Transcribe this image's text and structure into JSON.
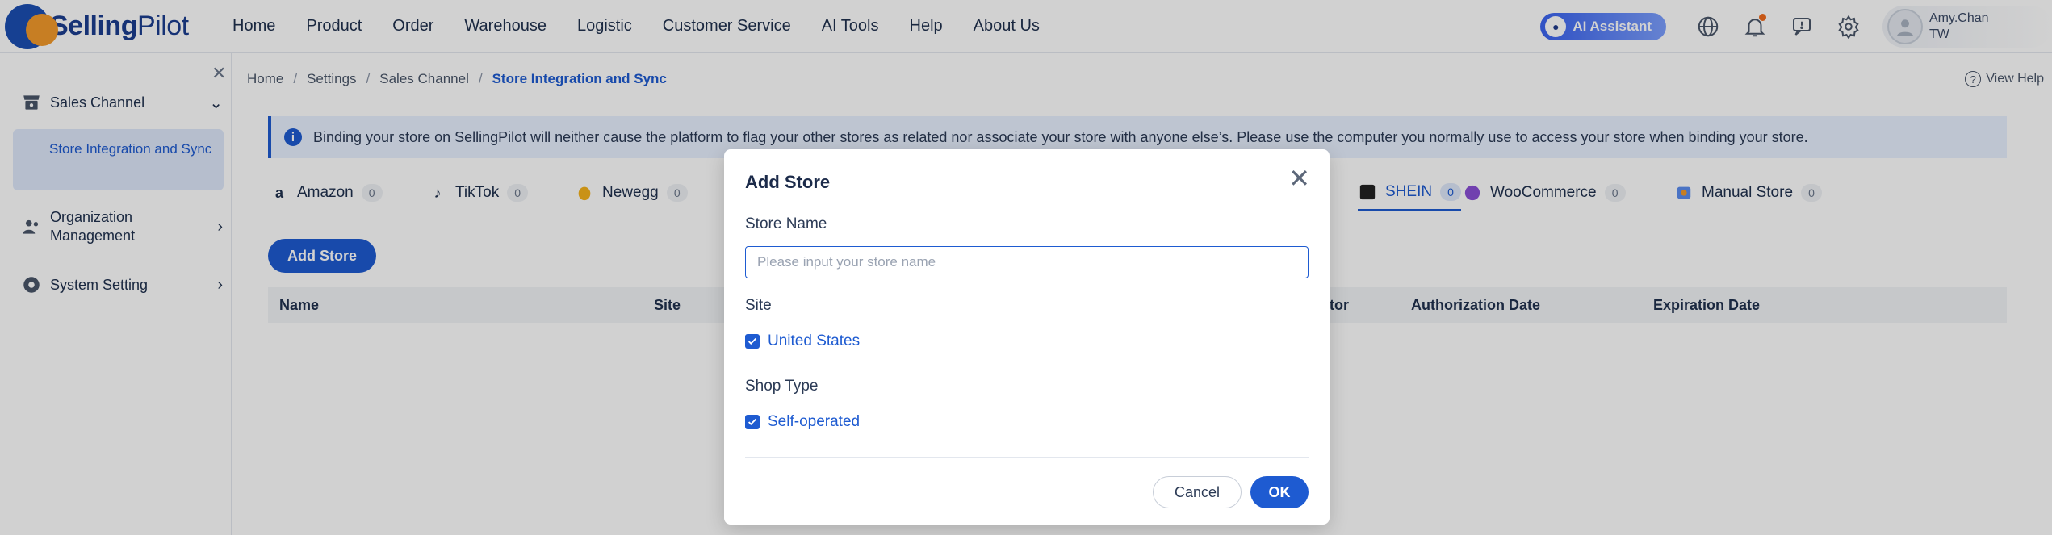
{
  "brand": {
    "name_bold": "Selling",
    "name_rest": "Pilot"
  },
  "nav": [
    "Home",
    "Product",
    "Order",
    "Warehouse",
    "Logistic",
    "Customer Service",
    "AI Tools",
    "Help",
    "About Us"
  ],
  "header": {
    "ai_assistant": "AI Assistant",
    "user_name": "Amy.Chan",
    "user_region": "TW"
  },
  "sidebar": {
    "groups": [
      {
        "label": "Sales Channel",
        "expanded": true
      },
      {
        "label": "Organization Management",
        "expanded": false
      },
      {
        "label": "System Setting",
        "expanded": false
      }
    ],
    "active_item": "Store Integration and Sync"
  },
  "breadcrumb": [
    "Home",
    "Settings",
    "Sales Channel",
    "Store Integration and Sync"
  ],
  "view_help": "View Help",
  "info_text": "Binding your store on SellingPilot will neither cause the platform to flag your other stores as related nor associate your store with anyone else’s. Please use the computer you normally use to access your store when binding your store.",
  "tabs": [
    {
      "label": "Amazon",
      "count": "0"
    },
    {
      "label": "TikTok",
      "count": "0"
    },
    {
      "label": "Newegg",
      "count": "0"
    },
    {
      "label": "SHEIN",
      "count": "0",
      "active": true
    },
    {
      "label": "WooCommerce",
      "count": "0"
    },
    {
      "label": "Manual Store",
      "count": "0"
    }
  ],
  "add_store_label": "Add Store",
  "table_headers": [
    "Name",
    "Site",
    "ator",
    "Authorization Date",
    "Expiration Date"
  ],
  "modal": {
    "title": "Add Store",
    "store_name_label": "Store Name",
    "store_name_value": "",
    "store_name_placeholder": "Please input your store name",
    "site_label": "Site",
    "site_option": "United States",
    "site_checked": true,
    "shop_type_label": "Shop Type",
    "shop_type_option": "Self-operated",
    "shop_type_checked": true,
    "cancel_label": "Cancel",
    "ok_label": "OK"
  },
  "colors": {
    "primary": "#1e5bd1",
    "accent": "#f39a2b",
    "brand_dark": "#1b4fb3"
  }
}
